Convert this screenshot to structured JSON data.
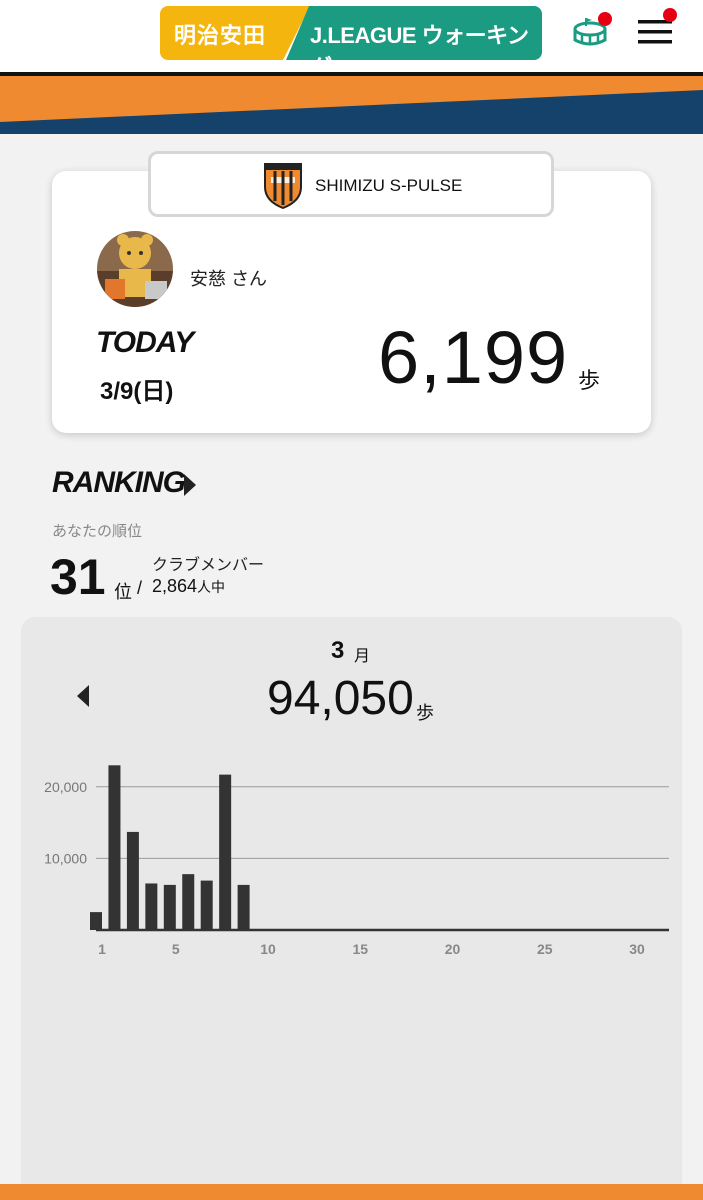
{
  "header": {
    "logo_left": "明治安田",
    "logo_right": "J.LEAGUE ウォーキング",
    "colors": {
      "yellow": "#f5b50f",
      "green": "#1a9b82",
      "orange": "#f08a30",
      "navy": "#14426b",
      "badge": "#e60012"
    }
  },
  "card": {
    "club_name": "SHIMIZU S-PULSE",
    "user_name": "安慈 さん",
    "today_label": "TODAY",
    "date": "3/9(日)",
    "steps": "6,199",
    "steps_unit": "歩"
  },
  "ranking": {
    "title": "RANKING",
    "rank_label": "あなたの順位",
    "rank": "31",
    "rank_unit": "位",
    "slash": "/",
    "members_label": "クラブメンバー",
    "members_count": "2,864",
    "members_unit": "人中"
  },
  "monthly": {
    "month": "3",
    "month_unit": "月",
    "total": "94,050",
    "total_unit": "歩"
  },
  "chart_data": {
    "type": "bar",
    "x": [
      1,
      2,
      3,
      4,
      5,
      6,
      7,
      8,
      9
    ],
    "values": [
      2500,
      23000,
      13700,
      6500,
      6300,
      7800,
      6900,
      21700,
      6300
    ],
    "xlim": [
      1,
      31
    ],
    "ylim": [
      0,
      25000
    ],
    "y_ticks": [
      "10,000",
      "20,000"
    ],
    "y_tick_values": [
      10000,
      20000
    ],
    "x_ticks": [
      "1",
      "5",
      "10",
      "15",
      "20",
      "25",
      "30"
    ],
    "x_tick_values": [
      1,
      5,
      10,
      15,
      20,
      25,
      30
    ],
    "grid": true
  }
}
